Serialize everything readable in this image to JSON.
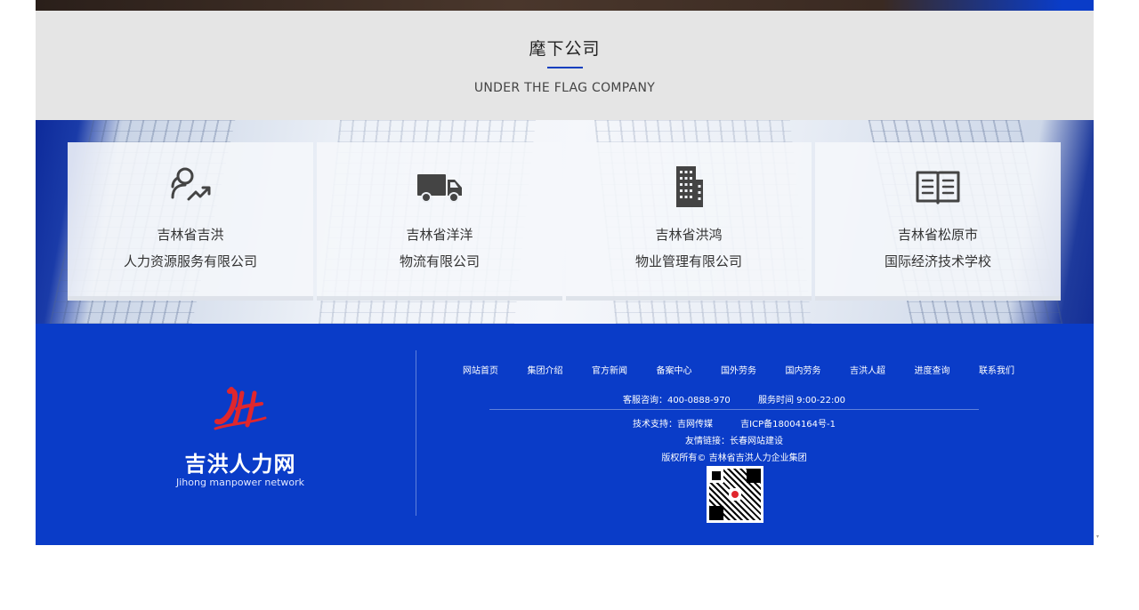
{
  "section": {
    "title": "麾下公司",
    "subtitle": "UNDER THE FLAG COMPANY"
  },
  "companies": [
    {
      "icon": "people-growth-icon",
      "line1": "吉林省吉洪",
      "line2": "人力资源服务有限公司"
    },
    {
      "icon": "truck-icon",
      "line1": "吉林省洋洋",
      "line2": "物流有限公司"
    },
    {
      "icon": "building-icon",
      "line1": "吉林省洪鸿",
      "line2": "物业管理有限公司"
    },
    {
      "icon": "book-icon",
      "line1": "吉林省松原市",
      "line2": "国际经济技术学校"
    }
  ],
  "footer": {
    "logo_name": "吉洪人力网",
    "logo_en": "Jihong manpower network",
    "nav": [
      "网站首页",
      "集团介绍",
      "官方新闻",
      "备案中心",
      "国外劳务",
      "国内劳务",
      "吉洪人超",
      "进度查询",
      "联系我们"
    ],
    "hotline": "客服咨询：400-0888-970",
    "hours": "服务时间 9:00-22:00",
    "tech_support": "技术支持：吉网传媒",
    "icp": "吉ICP备18004164号-1",
    "links": "友情链接：长春网站建设",
    "copyright": "版权所有© 吉林省吉洪人力企业集团"
  },
  "colors": {
    "brand_blue": "#0a3cc8",
    "logo_red": "#e0262d",
    "header_bg": "#e5e5e5"
  }
}
